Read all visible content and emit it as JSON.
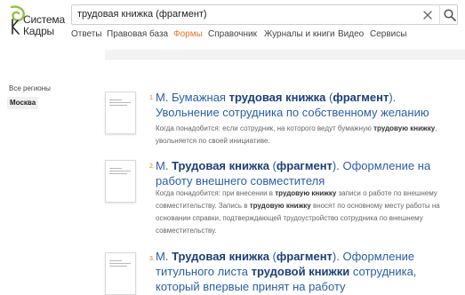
{
  "logo": {
    "line1": "Система",
    "line2": "Кадры"
  },
  "search": {
    "value": "трудовая книжка (фрагмент)"
  },
  "nav": [
    {
      "label": "Ответы"
    },
    {
      "label": "Правовая база"
    },
    {
      "label": "Формы"
    },
    {
      "label": "Справочник"
    },
    {
      "label": "Журналы и книги"
    },
    {
      "label": "Видео"
    },
    {
      "label": "Сервисы"
    }
  ],
  "nav_active": "Формы",
  "sidebar": {
    "title": "Все регионы",
    "item": "Москва"
  },
  "results": [
    {
      "num": "1.",
      "title": [
        {
          "t": "М. Бумажная "
        },
        {
          "t": "трудовая книжка",
          "b": true
        },
        {
          "t": " ("
        },
        {
          "t": "фрагмент",
          "b": true
        },
        {
          "t": "). Увольнение сотрудника по собственному желанию"
        }
      ],
      "desc": [
        {
          "t": "Когда понадобится: если сотрудник, на которого ведут бумажную "
        },
        {
          "t": "трудовую книжку",
          "b": true
        },
        {
          "t": ", увольняется по своей инициативе."
        }
      ]
    },
    {
      "num": "2.",
      "title": [
        {
          "t": "М. "
        },
        {
          "t": "Трудовая книжка",
          "b": true
        },
        {
          "t": " ("
        },
        {
          "t": "фрагмент",
          "b": true
        },
        {
          "t": "). Оформление на работу внешнего совместителя"
        }
      ],
      "desc": [
        {
          "t": "Когда понадобится: при внесении в "
        },
        {
          "t": "трудовую книжку",
          "b": true
        },
        {
          "t": " записи о работе по внешнему совместительству. Запись в "
        },
        {
          "t": "трудовую книжку",
          "b": true
        },
        {
          "t": " вносят по основному месту работы на основании справки, подтверждающей трудоустройство сотрудника по внешнему совместительству."
        }
      ]
    },
    {
      "num": "3.",
      "title": [
        {
          "t": "М. "
        },
        {
          "t": "Трудовая книжка",
          "b": true
        },
        {
          "t": " ("
        },
        {
          "t": "фрагмент",
          "b": true
        },
        {
          "t": "). Оформление титульного листа "
        },
        {
          "t": "трудовой книжки",
          "b": true
        },
        {
          "t": " сотрудника, который впервые принят на работу"
        }
      ],
      "desc": []
    }
  ],
  "colors": {
    "accent": "#e8742a",
    "link": "#2b5ea8",
    "logo_green": "#8cc63f"
  },
  "icons": {
    "clear": "close-icon",
    "search": "search-icon",
    "logo": "logo-icon",
    "document": "document-thumbnail"
  }
}
